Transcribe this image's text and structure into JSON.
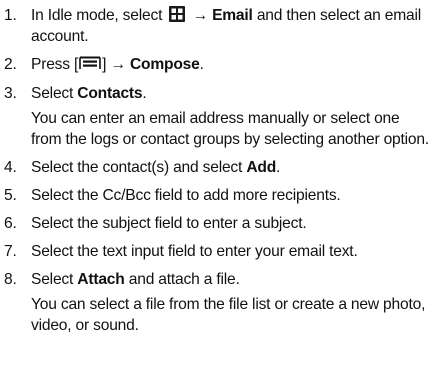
{
  "steps": [
    {
      "num": "1.",
      "pre": "In Idle mode, select",
      "icon": "menu-grid-icon",
      "arrow": "→",
      "bold": "Email",
      "post": "and then select an email account."
    },
    {
      "num": "2.",
      "pre": "Press [",
      "icon": "menu-key-icon",
      "mid": "] →",
      "bold": "Compose",
      "post": "."
    },
    {
      "num": "3.",
      "pre": "Select",
      "bold": "Contacts",
      "post": ".",
      "note": "You can enter an email address manually or select one from the logs or contact groups by selecting another option."
    },
    {
      "num": "4.",
      "pre": "Select the contact(s) and select",
      "bold": "Add",
      "post": "."
    },
    {
      "num": "5.",
      "text": "Select the Cc/Bcc field to add more recipients."
    },
    {
      "num": "6.",
      "text": "Select the subject field to enter a subject."
    },
    {
      "num": "7.",
      "text": "Select the text input field to enter your email text."
    },
    {
      "num": "8.",
      "pre": "Select",
      "bold": "Attach",
      "post": "and attach a file.",
      "note": "You can select a file from the file list or create a new photo, video, or sound."
    }
  ]
}
